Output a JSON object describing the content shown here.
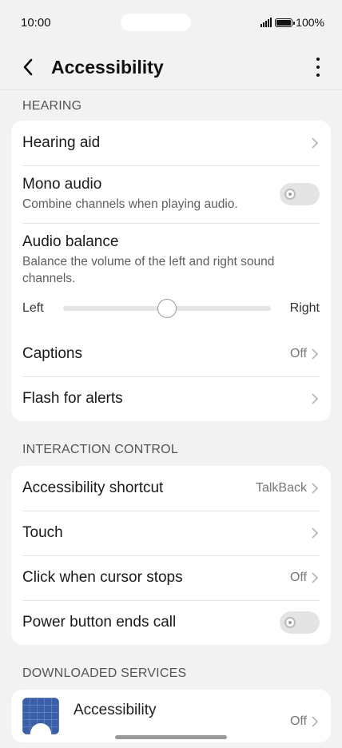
{
  "status": {
    "time": "10:00",
    "battery": "100%"
  },
  "header": {
    "title": "Accessibility"
  },
  "hearing": {
    "section_title": "HEARING",
    "hearing_aid": "Hearing aid",
    "mono_audio": {
      "label": "Mono audio",
      "sub": "Combine channels when playing audio.",
      "enabled": false
    },
    "audio_balance": {
      "label": "Audio balance",
      "sub": "Balance the volume of the left and right sound channels.",
      "left": "Left",
      "right": "Right",
      "position": 0.5
    },
    "captions": {
      "label": "Captions",
      "value": "Off"
    },
    "flash": "Flash for alerts"
  },
  "interaction": {
    "section_title": "INTERACTION CONTROL",
    "shortcut": {
      "label": "Accessibility shortcut",
      "value": "TalkBack"
    },
    "touch": "Touch",
    "click_cursor": {
      "label": "Click when cursor stops",
      "value": "Off"
    },
    "power_button": {
      "label": "Power button ends call",
      "enabled": false
    }
  },
  "downloaded": {
    "section_title": "DOWNLOADED SERVICES",
    "app": {
      "label": "Accessibility",
      "value": "Off"
    }
  },
  "icons": {
    "back": "chevron-left-icon",
    "more": "more-vertical-icon",
    "chevron": "chevron-right-icon"
  }
}
